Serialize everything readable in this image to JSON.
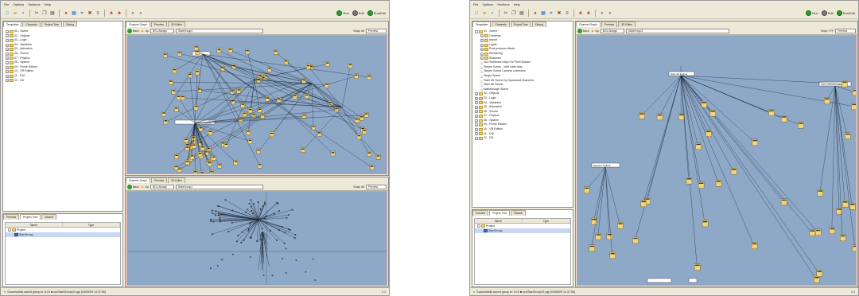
{
  "screenshots": [
    {
      "menu": [
        "File",
        "Options",
        "Sections",
        "Help"
      ],
      "toolbar_run": [
        {
          "label": "Run"
        },
        {
          "label": "Edit"
        },
        {
          "label": "Run/Edit"
        }
      ],
      "left_tabs": [
        "Templates",
        "Channels",
        "Project Tree",
        "Debug"
      ],
      "tree_items": [
        "00 - Scene",
        "02 - Objects",
        "03 - Logic",
        "04 - Variables",
        "05 - Animation",
        "06 - Sound",
        "07 - Physics",
        "08 - System",
        "09 - Prone Edition",
        "10 - VR Edition",
        "11 - GUI",
        "12 - DD"
      ],
      "graph_tabs": [
        "Channel Graph",
        "Preview",
        "3D Editor"
      ],
      "graph_back": "Back",
      "graph_up": "Up",
      "graph_filter": "BGL Always",
      "graph_path": "StartGroup1",
      "graph_snap": "Snap: ##",
      "graph_preview": "Preview",
      "lower_tabs": [
        "Channel Graph",
        "Preview",
        "3D Editor"
      ],
      "bottom_tabs": [
        "Preview",
        "Project Tree",
        "Search"
      ],
      "proj_columns": [
        "Name",
        "Type"
      ],
      "proj_rows": [
        {
          "label": "Project"
        },
        {
          "label": "StartGroup"
        }
      ],
      "status_text": "Successfully saved group to: 5:10 ■ ros\\StartGroup\\S.cgp (04/06/09 14:37:56)",
      "status_zoom": "1:1"
    },
    {
      "menu": [
        "File",
        "Options",
        "Sections",
        "Help"
      ],
      "toolbar_run": [
        {
          "label": "Run"
        },
        {
          "label": "Edit"
        },
        {
          "label": "Run/Edit"
        }
      ],
      "left_tabs": [
        "Templates",
        "Channels",
        "Project Tree",
        "Debug"
      ],
      "tree_root": "01 - Scene",
      "tree_children": [
        "Cameras",
        "Import",
        "Lights",
        "Post process effects",
        "Rendering",
        "Shadows"
      ],
      "tree_leaves": [
        "Sun Reflection Map For Pixel Shader",
        "Simple Scene - with cube map",
        "Simple Scene Camera correction",
        "Single Scene",
        "Start 3D Scene by Separated Channels",
        "Start 3D Scene",
        "Walkthrough Scene"
      ],
      "tree_items": [
        "02 - Objects",
        "03 - Logic",
        "04 - Variables",
        "05 - Animation",
        "06 - Sound",
        "07 - Physics",
        "08 - System",
        "09 - Prone Edition",
        "10 - VR Edition",
        "11 - GUI",
        "12 - DD"
      ],
      "graph_tabs": [
        "Channel Graph",
        "Preview",
        "3D Editor"
      ],
      "graph_back": "Back",
      "graph_up": "Up",
      "graph_filter": "BGL Always",
      "graph_path": "StartGroup1",
      "graph_snap": "Snap: TFF",
      "graph_preview": "Preview",
      "node_labels": [
        "Start 3D Engine",
        "Explorer Callout",
        "Sync_Channel Callout"
      ],
      "bottom_tabs": [
        "Preview",
        "Project Tree",
        "Search"
      ],
      "proj_columns": [
        "Name",
        "Type"
      ],
      "proj_rows": [
        {
          "label": "Project"
        },
        {
          "label": "StartGroup"
        }
      ],
      "status_text": "Successfully saved group to: 5:10 ■ ros\\StartGroup\\S.cgp (04/06/09 14:37:56)",
      "status_zoom": "1:1"
    }
  ]
}
